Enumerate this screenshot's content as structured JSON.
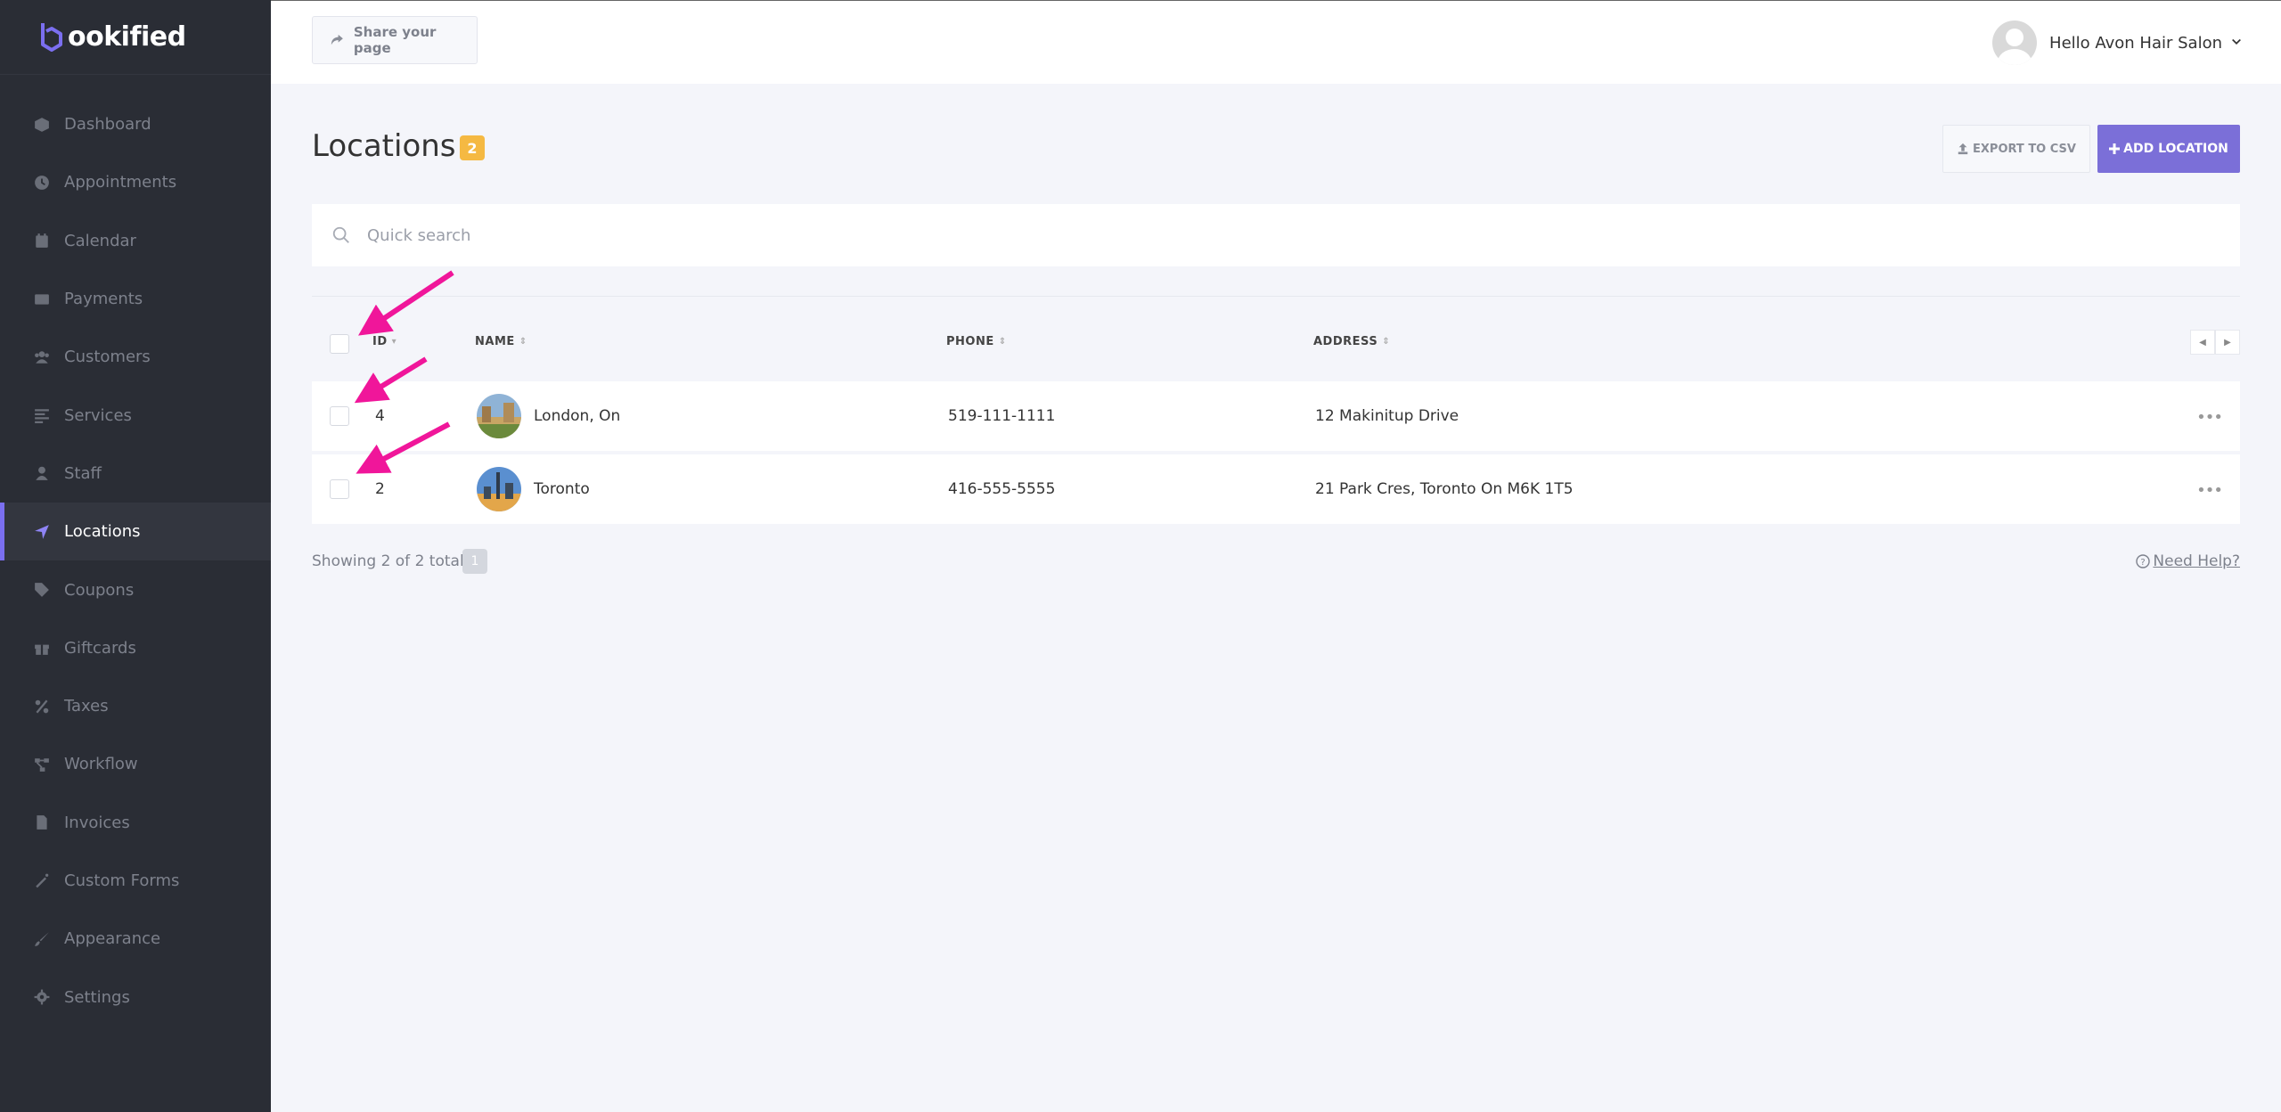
{
  "brand": {
    "logo_text": "ookified",
    "accent": "#7b6fd8"
  },
  "sidebar": {
    "items": [
      {
        "label": "Dashboard",
        "icon": "cube-icon"
      },
      {
        "label": "Appointments",
        "icon": "clock-icon"
      },
      {
        "label": "Calendar",
        "icon": "calendar-icon"
      },
      {
        "label": "Payments",
        "icon": "credit-card-icon"
      },
      {
        "label": "Customers",
        "icon": "users-icon"
      },
      {
        "label": "Services",
        "icon": "list-icon"
      },
      {
        "label": "Staff",
        "icon": "user-icon"
      },
      {
        "label": "Locations",
        "icon": "location-arrow-icon",
        "active": true
      },
      {
        "label": "Coupons",
        "icon": "tag-icon"
      },
      {
        "label": "Giftcards",
        "icon": "gift-icon"
      },
      {
        "label": "Taxes",
        "icon": "percent-icon"
      },
      {
        "label": "Workflow",
        "icon": "workflow-icon"
      },
      {
        "label": "Invoices",
        "icon": "file-icon"
      },
      {
        "label": "Custom Forms",
        "icon": "magic-wand-icon"
      },
      {
        "label": "Appearance",
        "icon": "brush-icon"
      },
      {
        "label": "Settings",
        "icon": "gear-icon"
      }
    ]
  },
  "topbar": {
    "share_label": "Share your page",
    "user_greeting": "Hello Avon Hair Salon"
  },
  "page": {
    "title": "Locations",
    "count": "2",
    "export_label": "EXPORT TO CSV",
    "add_label": "ADD LOCATION"
  },
  "search": {
    "placeholder": "Quick search"
  },
  "table": {
    "headers": {
      "id": "ID",
      "name": "NAME",
      "phone": "PHONE",
      "address": "ADDRESS"
    },
    "rows": [
      {
        "id": "4",
        "name": "London, On",
        "phone": "519-111-1111",
        "address": "12 Makinitup Drive"
      },
      {
        "id": "2",
        "name": "Toronto",
        "phone": "416-555-5555",
        "address": "21 Park Cres, Toronto On M6K 1T5"
      }
    ]
  },
  "footer": {
    "showing": "Showing 2 of 2 total",
    "page": "1",
    "help": "Need Help?"
  },
  "annotation_color": "#f0169a"
}
